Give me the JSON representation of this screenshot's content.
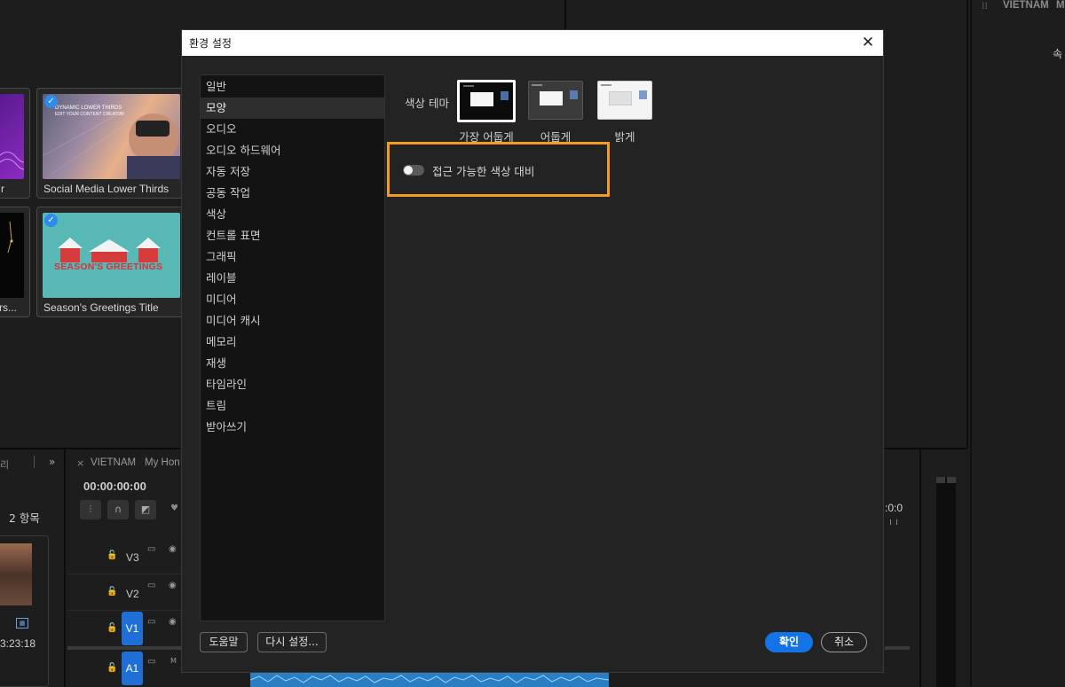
{
  "dialog": {
    "title": "환경 설정",
    "close_label": "✕",
    "categories": [
      "일반",
      "모양",
      "오디오",
      "오디오 하드웨어",
      "자동 저장",
      "공동 작업",
      "색상",
      "컨트롤 표면",
      "그래픽",
      "레이블",
      "미디어",
      "미디어 캐시",
      "메모리",
      "재생",
      "타임라인",
      "트림",
      "받아쓰기"
    ],
    "selected_category": "모양",
    "theme": {
      "label": "색상 테마",
      "options": [
        "가장 어둡게",
        "어둡게",
        "밝게"
      ],
      "selected": "가장 어둡게"
    },
    "contrast_toggle": {
      "label": "접근 가능한 색상 대비",
      "on": false
    },
    "buttons": {
      "help": "도움말",
      "reset": "다시 설정...",
      "ok": "확인",
      "cancel": "취소"
    },
    "highlight_color": "#f39b23",
    "accent_color": "#1473e6"
  },
  "background": {
    "top_right_tab": "VIETNAM",
    "top_right_tab_suffix": "M",
    "top_right_text": "속",
    "cards": [
      {
        "label": "r"
      },
      {
        "label": "Social Media Lower Thirds",
        "thumb_text_1": "DYNAMIC LOWER THIRDS",
        "thumb_text_2": "EDIT YOUR CONTENT CREATOR"
      },
      {
        "label": "rs..."
      },
      {
        "label": "Season's Greetings Title",
        "thumb_text": "SEASON'S GREETINGS"
      }
    ],
    "project_panel": {
      "close_fragment": "리",
      "items_count": "2 항목",
      "clip_duration": "3:23:18"
    },
    "timeline": {
      "tab_name": "VIETNAM",
      "tab_name_2": "My Hon",
      "timecode": "00:00:00:00",
      "right_timecode": ":0:0",
      "tracks": [
        "V3",
        "V2",
        "V1",
        "A1"
      ],
      "track_a1_flag": "M"
    }
  }
}
